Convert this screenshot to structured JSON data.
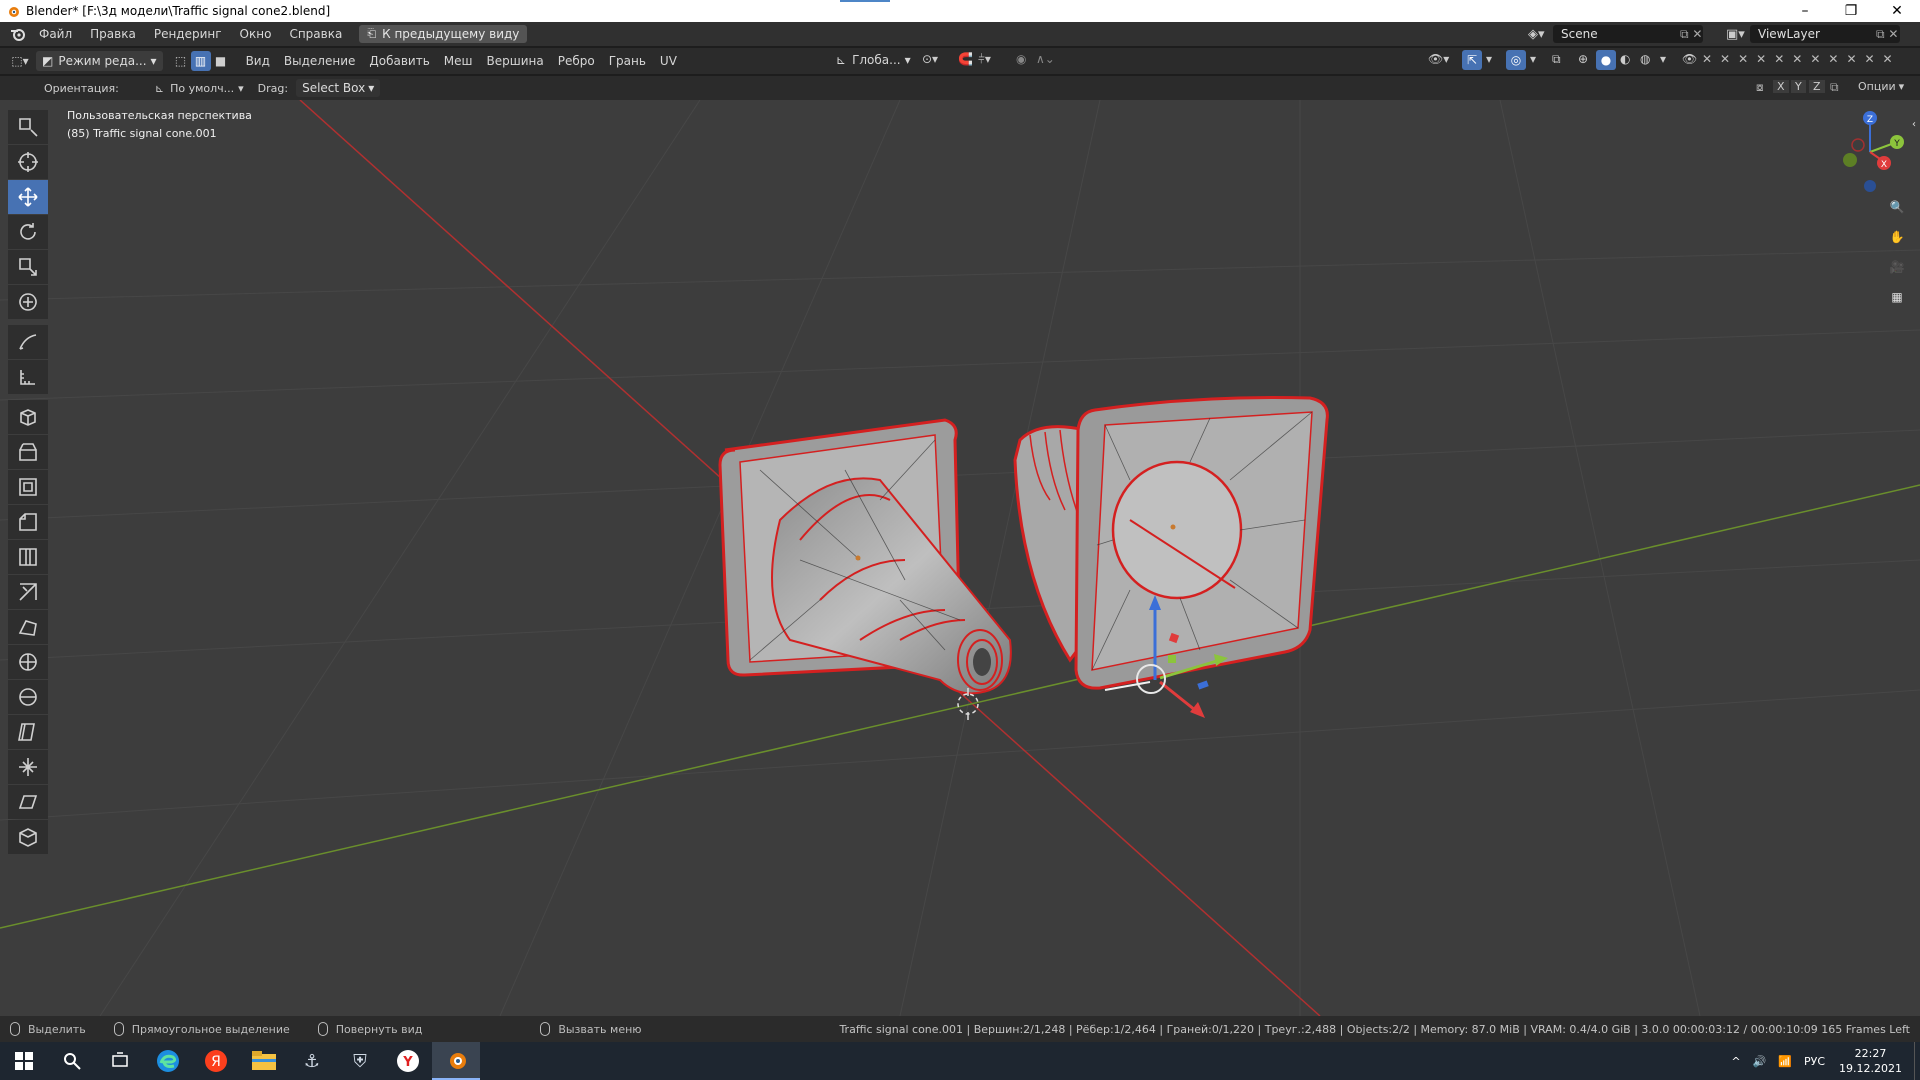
{
  "window": {
    "title": "Blender* [F:\\3д модели\\Traffic signal cone2.blend]",
    "controls": [
      "minimize-icon",
      "restore-icon",
      "close-icon"
    ]
  },
  "menubar": {
    "items": [
      "Файл",
      "Правка",
      "Рендеринг",
      "Окно",
      "Справка"
    ],
    "back_button": "К предыдущему виду",
    "scene_label": "Scene",
    "viewlayer_label": "ViewLayer"
  },
  "header": {
    "mode": "Режим реда...",
    "menus": [
      "Вид",
      "Выделение",
      "Добавить",
      "Меш",
      "Вершина",
      "Ребро",
      "Грань",
      "UV"
    ],
    "transform_orientation": "Глоба...",
    "options_label": "Опции",
    "axes": [
      "X",
      "Y",
      "Z"
    ]
  },
  "tool_settings": {
    "orientation_label": "Ориентация:",
    "orientation_value": "По умолч...",
    "drag_label": "Drag:",
    "drag_value": "Select Box"
  },
  "viewport": {
    "view_name": "Пользовательская перспектива",
    "object_info": "(85) Traffic signal cone.001",
    "gizmo_axes": [
      "X",
      "Y",
      "Z"
    ]
  },
  "tools": [
    "select-box-icon",
    "cursor-icon",
    "move-icon",
    "rotate-icon",
    "scale-icon",
    "transform-icon",
    "annotate-icon",
    "measure-icon",
    "add-cube-icon",
    "extrude-icon",
    "inset-icon",
    "bevel-icon",
    "loop-cut-icon",
    "knife-icon",
    "poly-build-icon",
    "spin-icon",
    "smooth-icon",
    "edge-slide-icon",
    "shrink-fatten-icon",
    "shear-icon",
    "rip-icon"
  ],
  "active_tool": 2,
  "statusbar": {
    "hints": [
      "Выделить",
      "Прямоугольное выделение",
      "Повернуть вид",
      "Вызвать меню"
    ],
    "stats": "Traffic signal cone.001 | Вершин:2/1,248 | Рёбер:1/2,464 | Граней:0/1,220 | Треуг.:2,488 | Objects:2/2 | Memory: 87.0 MiB | VRAM: 0.4/4.0 GiB | 3.0.0  00:00:03:12 / 00:00:10:09 165 Frames Left"
  },
  "taskbar": {
    "language": "РУС",
    "time": "22:27",
    "date": "19.12.2021"
  },
  "colors": {
    "accent": "#4772b3",
    "viewport_bg": "#3d3d3d",
    "edge_selected": "#d42020",
    "axis_x": "#b03030",
    "axis_y": "#6a8f2c"
  }
}
